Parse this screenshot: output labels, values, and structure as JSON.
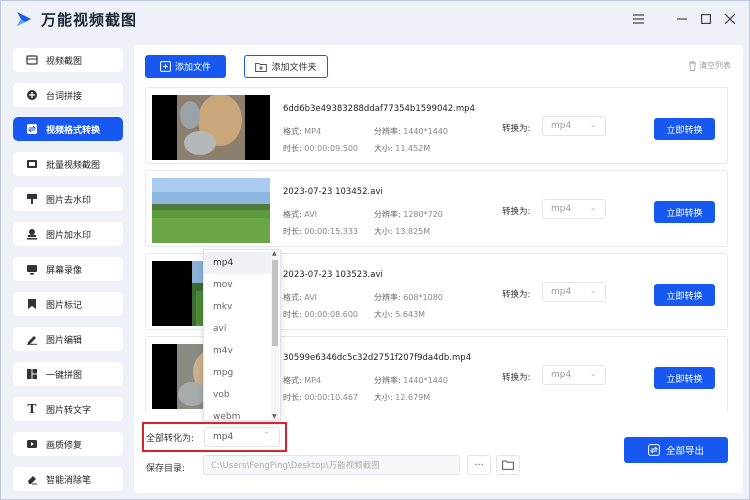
{
  "app": {
    "title": "万能视频截图",
    "brand_color": "#1758f0"
  },
  "sidebar": {
    "items": [
      {
        "label": "视频截图",
        "icon": "film-icon"
      },
      {
        "label": "台词拼接",
        "icon": "plus-circle-icon"
      },
      {
        "label": "视频格式转换",
        "icon": "convert-icon",
        "active": true
      },
      {
        "label": "批量视频截图",
        "icon": "batch-screenshot-icon"
      },
      {
        "label": "图片去水印",
        "icon": "brush-icon"
      },
      {
        "label": "图片加水印",
        "icon": "stamp-icon"
      },
      {
        "label": "屏幕录像",
        "icon": "screen-record-icon"
      },
      {
        "label": "图片标记",
        "icon": "bookmark-icon"
      },
      {
        "label": "图片编辑",
        "icon": "pencil-icon"
      },
      {
        "label": "一键拼图",
        "icon": "grid-icon"
      },
      {
        "label": "图片转文字",
        "icon": "text-icon"
      },
      {
        "label": "画质修复",
        "icon": "video-repair-icon"
      },
      {
        "label": "智能消除笔",
        "icon": "eraser-icon"
      }
    ]
  },
  "toolbar": {
    "add_file_label": "添加文件",
    "add_folder_label": "添加文件夹",
    "clear_list_label": "清空列表"
  },
  "labels": {
    "format": "格式:",
    "resolution": "分辨率:",
    "duration": "时长:",
    "size": "大小:",
    "convert_to": "转换为:",
    "convert_now": "立即转换"
  },
  "files": [
    {
      "name": "6dd6b3e49383288ddaf77354b1599042.mp4",
      "format": "MP4",
      "resolution": "1440*1440",
      "duration": "00:00:09.500",
      "size": "11.452M",
      "target": "mp4"
    },
    {
      "name": "2023-07-23 103452.avi",
      "format": "AVI",
      "resolution": "1280*720",
      "duration": "00:00:15.333",
      "size": "13.825M",
      "target": "mp4"
    },
    {
      "name": "2023-07-23 103523.avi",
      "format": "AVI",
      "resolution": "608*1080",
      "duration": "00:00:08.600",
      "size": "5.643M",
      "target": "mp4"
    },
    {
      "name": "30599e6346dc5c32d2751f207f9da4db.mp4",
      "format": "MP4",
      "resolution": "1440*1440",
      "duration": "00:00:10.467",
      "size": "12.679M",
      "target": "mp4"
    }
  ],
  "dropdown": {
    "options": [
      "mp4",
      "mov",
      "mkv",
      "avi",
      "m4v",
      "mpg",
      "vob",
      "webm"
    ],
    "selected": "mp4"
  },
  "bottom": {
    "convert_all_label": "全部转化为:",
    "convert_all_value": "mp4",
    "save_dir_label": "保存目录:",
    "save_path": "C:\\Users\\FengPing\\Desktop\\万能视频截图",
    "more_label": "···",
    "export_all_label": "全部导出"
  }
}
